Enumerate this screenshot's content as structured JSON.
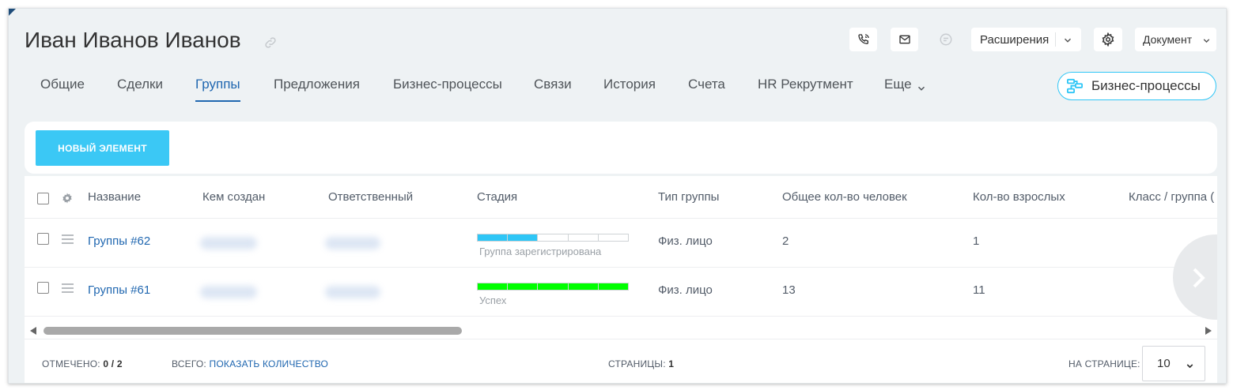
{
  "header": {
    "title": "Иван Иванов Иванов",
    "icons": [
      "link-icon",
      "phone-icon",
      "mail-icon",
      "chat-icon",
      "gear-icon",
      "chevron-down-icon"
    ],
    "extensions_label": "Расширения",
    "document_label": "Документ"
  },
  "tabs": [
    {
      "label": "Общие"
    },
    {
      "label": "Сделки"
    },
    {
      "label": "Группы",
      "active": true
    },
    {
      "label": "Предложения"
    },
    {
      "label": "Бизнес-процессы"
    },
    {
      "label": "Связи"
    },
    {
      "label": "История"
    },
    {
      "label": "Счета"
    },
    {
      "label": "HR Рекрутмент"
    },
    {
      "label": "Еще"
    }
  ],
  "bp_button": {
    "label": "Бизнес-процессы"
  },
  "toolbar": {
    "new_button": "НОВЫЙ ЭЛЕМЕНТ"
  },
  "grid": {
    "columns": [
      "Название",
      "Кем создан",
      "Ответственный",
      "Стадия",
      "Тип группы",
      "Общее кол-во человек",
      "Кол-во взрослых",
      "Класс / группа ("
    ],
    "rows": [
      {
        "name": "Группы #62",
        "stage": {
          "label": "Группа зарегистрирована",
          "filled": 2,
          "total": 5,
          "color": "#2fc6f6"
        },
        "type": "Физ. лицо",
        "total": "2",
        "adults": "1"
      },
      {
        "name": "Группы #61",
        "stage": {
          "label": "Успех",
          "filled": 5,
          "total": 5,
          "color": "#00ff00"
        },
        "type": "Физ. лицо",
        "total": "13",
        "adults": "11"
      }
    ]
  },
  "footer": {
    "marked_label": "ОТМЕЧЕНО:",
    "marked_value": "0 / 2",
    "total_label": "ВСЕГО:",
    "total_link": "ПОКАЗАТЬ КОЛИЧЕСТВО",
    "pages_label": "СТРАНИЦЫ:",
    "pages_value": "1",
    "per_page_label": "НА СТРАНИЦЕ:",
    "per_page_value": "10"
  },
  "colors": {
    "accent": "#2067b0",
    "button": "#3bc8f5",
    "bp_border": "#2fc6f6"
  }
}
